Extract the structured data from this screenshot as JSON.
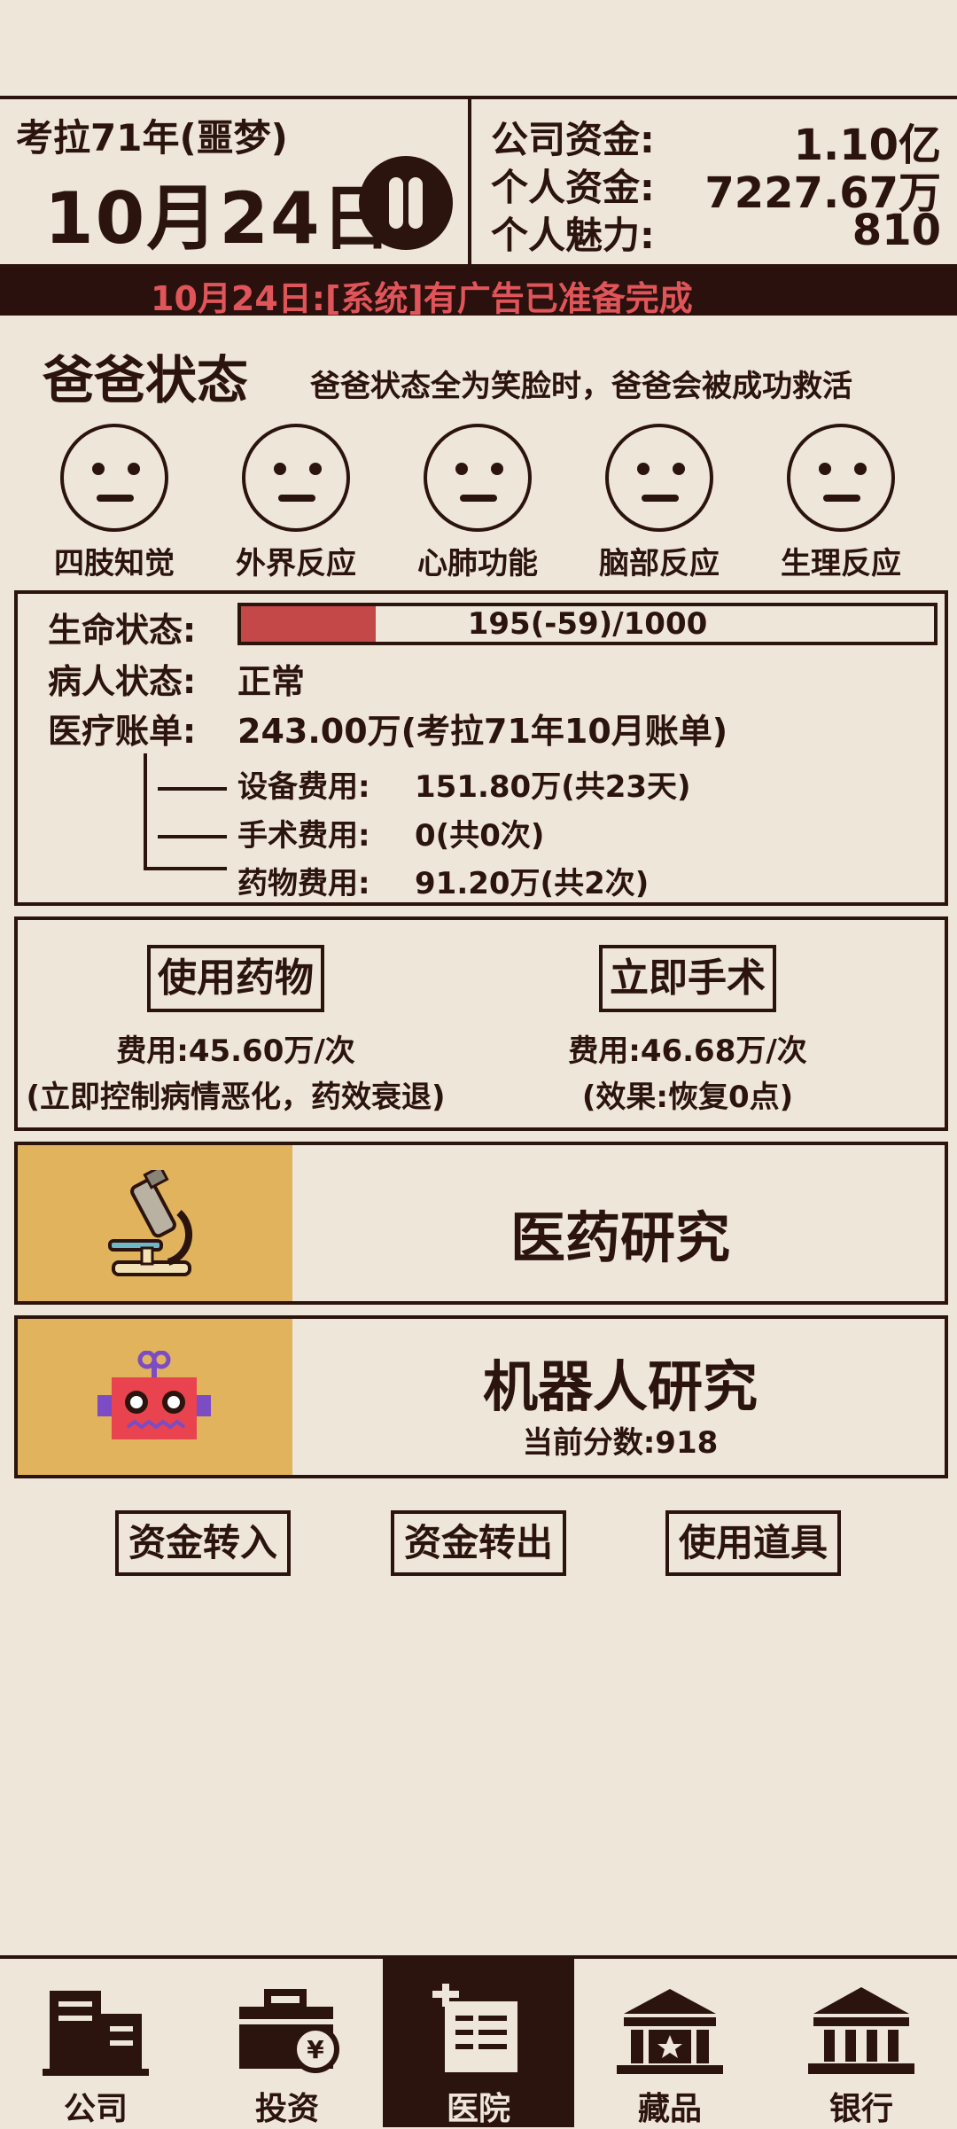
{
  "header": {
    "era": "考拉71年(噩梦)",
    "date": "10月24日",
    "pause_icon": "pause-icon",
    "company_funds_label": "公司资金:",
    "company_funds_value": "1.10亿",
    "personal_funds_label": "个人资金:",
    "personal_funds_value": "7227.67万",
    "charm_label": "个人魅力:",
    "charm_value": "810"
  },
  "ticker": {
    "text": "10月24日:[系统]有广告已准备完成"
  },
  "dad_status": {
    "title": "爸爸状态",
    "hint": "爸爸状态全为笑脸时，爸爸会被成功救活",
    "indicators": [
      {
        "label": "四肢知觉",
        "icon": "neutral-face-icon"
      },
      {
        "label": "外界反应",
        "icon": "neutral-face-icon"
      },
      {
        "label": "心肺功能",
        "icon": "neutral-face-icon"
      },
      {
        "label": "脑部反应",
        "icon": "neutral-face-icon"
      },
      {
        "label": "生理反应",
        "icon": "neutral-face-icon"
      }
    ]
  },
  "info": {
    "life_label": "生命状态:",
    "life_text": "195(-59)/1000",
    "life_fraction": 0.195,
    "life_color": "#c54848",
    "patient_label": "病人状态:",
    "patient_value": "正常",
    "bill_label": "医疗账单:",
    "bill_value": "243.00万(考拉71年10月账单)",
    "bill_items": [
      {
        "label": "设备费用:",
        "value": "151.80万(共23天)"
      },
      {
        "label": "手术费用:",
        "value": "0(共0次)"
      },
      {
        "label": "药物费用:",
        "value": "91.20万(共2次)"
      }
    ]
  },
  "actions": {
    "medicine": {
      "label": "使用药物",
      "cost": "费用:45.60万/次",
      "note": "(立即控制病情恶化，药效衰退)"
    },
    "surgery": {
      "label": "立即手术",
      "cost": "费用:46.68万/次",
      "note": "(效果:恢复0点)"
    }
  },
  "research": {
    "medical": {
      "title": "医药研究",
      "icon": "microscope-icon"
    },
    "robot": {
      "title": "机器人研究",
      "score": "当前分数:918",
      "icon": "robot-icon"
    }
  },
  "buttons": {
    "fund_in": "资金转入",
    "fund_out": "资金转出",
    "use_item": "使用道具"
  },
  "nav": {
    "items": [
      {
        "label": "公司",
        "icon": "office-building-icon"
      },
      {
        "label": "投资",
        "icon": "briefcase-yen-icon"
      },
      {
        "label": "医院",
        "icon": "hospital-icon",
        "active": true
      },
      {
        "label": "藏品",
        "icon": "museum-star-icon"
      },
      {
        "label": "银行",
        "icon": "bank-icon"
      }
    ]
  },
  "colors": {
    "background": "#eee6d8",
    "ink": "#2b130e",
    "accent_gold": "#e0b35c",
    "alert_red": "#e0555a"
  }
}
